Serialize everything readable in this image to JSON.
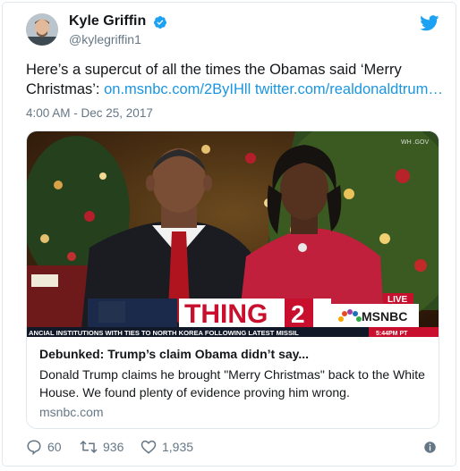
{
  "user": {
    "name": "Kyle Griffin",
    "handle": "@kylegriffin1"
  },
  "tweet": {
    "text": "Here’s a supercut of all the times the Obamas said ‘Merry Christmas’: ",
    "link1": "on.msnbc.com/2ByIHll",
    "link2": "twitter.com/realdonaldtrum…",
    "timestamp": "4:00 AM - Dec 25, 2017"
  },
  "card": {
    "media_watermark": "WH .GOV",
    "chyron_segment": "THING",
    "chyron_number": "2",
    "network": "MSNBC",
    "live_badge": "LIVE",
    "ticker": "ANCIAL INSTITUTIONS WITH TIES TO NORTH KOREA FOLLOWING LATEST MISSIL",
    "ticker_time": "5:44PM PT",
    "title": "Debunked: Trump’s claim Obama didn’t say...",
    "description": "Donald Trump claims he brought \"Merry Christmas\" back to the White House. We found plenty of evidence proving him wrong.",
    "domain": "msnbc.com"
  },
  "stats": {
    "replies": "60",
    "retweets": "936",
    "likes": "1,935"
  },
  "colors": {
    "twitter_blue": "#1da1f2",
    "link": "#1b95e0",
    "secondary": "#657786",
    "msnbc_red": "#c8102e"
  },
  "icons": [
    "verified-badge-icon",
    "twitter-bird-icon",
    "reply-icon",
    "retweet-icon",
    "like-icon",
    "info-icon"
  ]
}
